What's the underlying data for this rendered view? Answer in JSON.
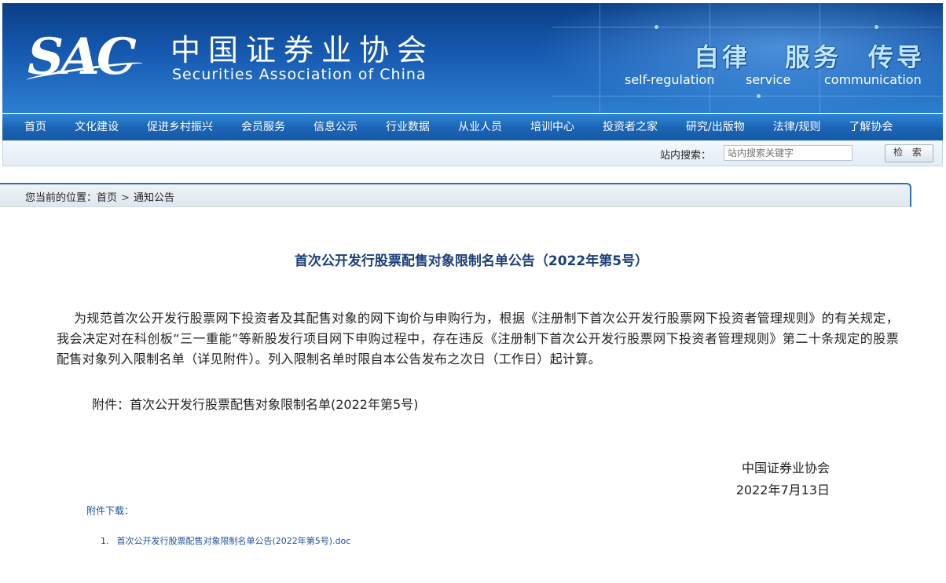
{
  "header": {
    "logo_text": "SAC",
    "org_name_cn": "中国证券业协会",
    "org_name_en": "Securities Association of China",
    "slogans": [
      {
        "cn": "自律",
        "en": "self-regulation"
      },
      {
        "cn": "服务",
        "en": "service"
      },
      {
        "cn": "传导",
        "en": "communication"
      }
    ]
  },
  "nav": {
    "items": [
      "首页",
      "文化建设",
      "促进乡村振兴",
      "会员服务",
      "信息公示",
      "行业数据",
      "从业人员",
      "培训中心",
      "投资者之家",
      "研究/出版物",
      "法律/规则",
      "了解协会"
    ]
  },
  "search": {
    "label": "站内搜索：",
    "placeholder": "站内搜索关键字",
    "button_label": "检 索"
  },
  "breadcrumb": {
    "prefix": "您当前的位置：",
    "items": [
      "首页",
      "通知公告"
    ],
    "separator": ">"
  },
  "article": {
    "title": "首次公开发行股票配售对象限制名单公告（2022年第5号）",
    "body": "为规范首次公开发行股票网下投资者及其配售对象的网下询价与申购行为，根据《注册制下首次公开发行股票网下投资者管理规则》的有关规定，我会决定对在科创板“三一重能”等新股发行项目网下申购过程中，存在违反《注册制下首次公开发行股票网下投资者管理规则》第二十条规定的股票配售对象列入限制名单（详见附件）。列入限制名单时限自本公告发布之次日（工作日）起计算。",
    "attachment_line": "附件：首次公开发行股票配售对象限制名单(2022年第5号)",
    "signature_org": "中国证券业协会",
    "signature_date": "2022年7月13日"
  },
  "downloads": {
    "label": "附件下载：",
    "items": [
      {
        "num": "1.",
        "name": "首次公开发行股票配售对象限制名单公告(2022年第5号).doc"
      }
    ]
  },
  "colors": {
    "banner_dark": "#0a3f86",
    "nav_blue": "#1b63b4",
    "title_blue": "#1c3f7a",
    "link_blue": "#1d4f9a"
  }
}
